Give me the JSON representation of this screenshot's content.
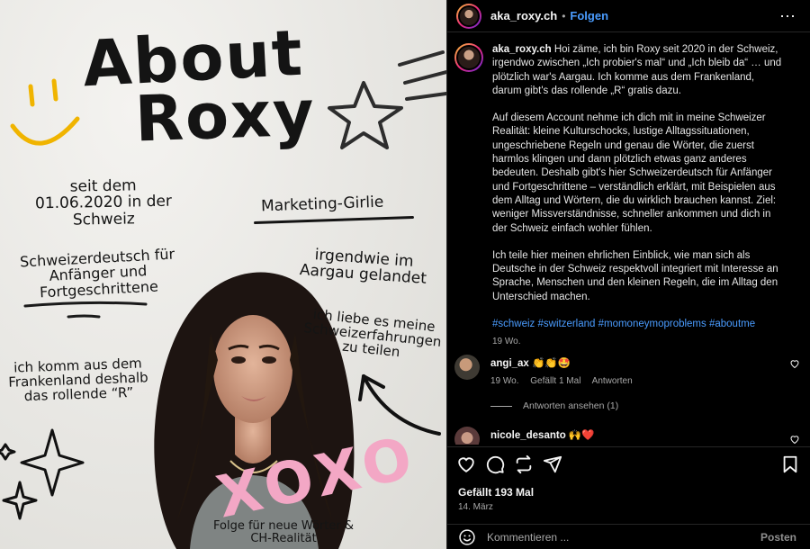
{
  "poster": {
    "title_line1": "About",
    "title_line2": "Roxy",
    "since": "seit dem 01.06.2020 in der Schweiz",
    "role": "Marketing-Girlie",
    "swiss_german": "Schweizerdeutsch für Anfänger und Fortgeschrittene",
    "aargau": "irgendwie im Aargau gelandet",
    "share": "ich liebe es meine Schweizerfahrungen zu teilen",
    "frankenland": "ich komm aus dem Frankenland deshalb das rollende “R”",
    "xoxo": "XOXO",
    "follow": "Folge für neue Wörter & CH-Realität"
  },
  "header": {
    "username": "aka_roxy.ch",
    "separator": "•",
    "follow_label": "Folgen",
    "more_icon": "⋯"
  },
  "caption": {
    "username": "aka_roxy.ch",
    "para1": "Hoi zäme, ich bin Roxy seit 2020 in der Schweiz, irgendwo zwischen „Ich probier's mal“ und „Ich bleib da“ … und plötzlich war's Aargau. Ich komme aus dem Frankenland, darum gibt's das rollende „R“ gratis dazu.",
    "para2": "Auf diesem Account nehme ich dich mit in meine Schweizer Realität: kleine Kulturschocks, lustige Alltagssituationen, ungeschriebene Regeln und genau die Wörter, die zuerst harmlos klingen und dann plötzlich etwas ganz anderes bedeuten. Deshalb gibt's hier Schweizerdeutsch für Anfänger und Fortgeschrittene – verständlich erklärt, mit Beispielen aus dem Alltag und Wörtern, die du wirklich brauchen kannst. Ziel: weniger Missverständnisse, schneller ankommen und dich in der Schweiz einfach wohler fühlen.",
    "para3": "Ich teile hier meinen ehrlichen Einblick, wie man sich als Deutsche in der Schweiz respektvoll integriert mit Interesse an Sprache, Menschen und den kleinen Regeln, die im Alltag den Unterschied machen.",
    "hashtags": "#schweiz #switzerland #momoneymoproblems #aboutme",
    "age": "19 Wo."
  },
  "comments": [
    {
      "username": "angi_ax",
      "emoji": "👏👏🤩",
      "age": "19 Wo.",
      "likes": "Gefällt 1 Mal",
      "reply_label": "Antworten",
      "view_replies": "Antworten ansehen (1)"
    },
    {
      "username": "nicole_desanto",
      "emoji": "🙌❤️"
    }
  ],
  "footer": {
    "likes": "Gefällt 193 Mal",
    "date": "14. März",
    "comment_placeholder": "Kommentieren ...",
    "post_label": "Posten"
  },
  "colors": {
    "accent": "#4a9cff",
    "panel_bg": "#000000",
    "xoxo_pink": "#f3a7c5"
  }
}
